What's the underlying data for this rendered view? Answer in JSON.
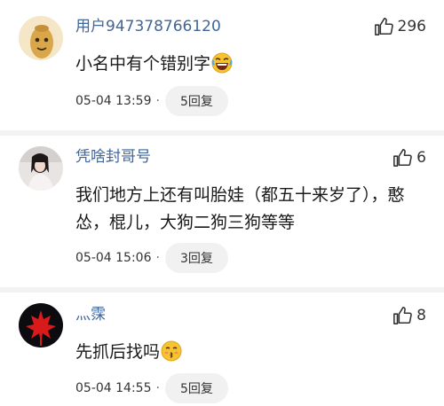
{
  "comments": [
    {
      "user": "用户947378766120",
      "likes": "296",
      "text": "小名中有个错别字",
      "emoji": "rolling-on-floor-laughing-emoji",
      "time": "05-04 13:59",
      "separator": "·",
      "replies": "5回复"
    },
    {
      "user": "凭啥封哥号",
      "likes": "6",
      "text": "我们地方上还有叫胎娃（都五十来岁了），憨怂，棍儿，大狗二狗三狗等等",
      "time": "05-04 15:06",
      "separator": "·",
      "replies": "3回复"
    },
    {
      "user": "灬霂",
      "likes": "8",
      "text": "先抓后找吗",
      "emoji": "kissing-face-emoji",
      "time": "05-04 14:55",
      "separator": "·",
      "replies": "5回复"
    }
  ]
}
